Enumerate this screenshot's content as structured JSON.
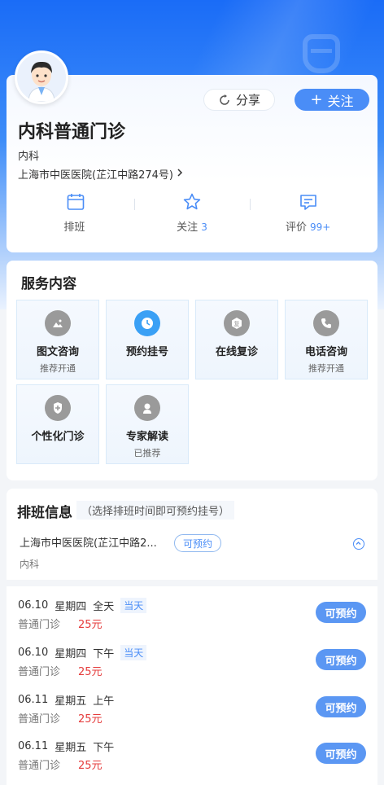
{
  "doctor": {
    "title": "内科普通门诊",
    "department": "内科",
    "hospital": "上海市中医医院(芷江中路274号)"
  },
  "actions": {
    "share_label": "分享",
    "follow_label": "关注"
  },
  "stats": [
    {
      "label": "排班",
      "count": "",
      "icon": "calendar-icon"
    },
    {
      "label": "关注",
      "count": "3",
      "icon": "star-icon"
    },
    {
      "label": "评价",
      "count": "99+",
      "icon": "comment-icon"
    }
  ],
  "services": {
    "title": "服务内容",
    "items": [
      {
        "name": "图文咨询",
        "sub": "推荐开通",
        "icon": "image-chat-icon",
        "color": "#9a9a9a"
      },
      {
        "name": "预约挂号",
        "sub": "",
        "icon": "clock-icon",
        "color": "#3aa0f5"
      },
      {
        "name": "在线复诊",
        "sub": "",
        "icon": "revisit-icon",
        "color": "#9a9a9a"
      },
      {
        "name": "电话咨询",
        "sub": "推荐开通",
        "icon": "phone-icon",
        "color": "#9a9a9a"
      },
      {
        "name": "个性化门诊",
        "sub": "",
        "icon": "personal-clinic-icon",
        "color": "#9a9a9a"
      },
      {
        "name": "专家解读",
        "sub": "已推荐",
        "icon": "expert-icon",
        "color": "#9a9a9a"
      }
    ]
  },
  "schedule": {
    "title": "排班信息",
    "hint": "（选择排班时间即可预约挂号）",
    "hospital": "上海市中医医院(芷江中路2...",
    "status": "可预约",
    "department": "内科",
    "slots": [
      {
        "date": "06.10",
        "weekday": "星期四",
        "period": "全天",
        "today": "当天",
        "type": "普通门诊",
        "price": "25元",
        "action": "可预约"
      },
      {
        "date": "06.10",
        "weekday": "星期四",
        "period": "下午",
        "today": "当天",
        "type": "普通门诊",
        "price": "25元",
        "action": "可预约"
      },
      {
        "date": "06.11",
        "weekday": "星期五",
        "period": "上午",
        "today": "",
        "type": "普通门诊",
        "price": "25元",
        "action": "可预约"
      },
      {
        "date": "06.11",
        "weekday": "星期五",
        "period": "下午",
        "today": "",
        "type": "普通门诊",
        "price": "25元",
        "action": "可预约"
      }
    ]
  },
  "colors": {
    "brand": "#1a6cf7",
    "accent": "#4a8df7",
    "price": "#e53b3b"
  }
}
